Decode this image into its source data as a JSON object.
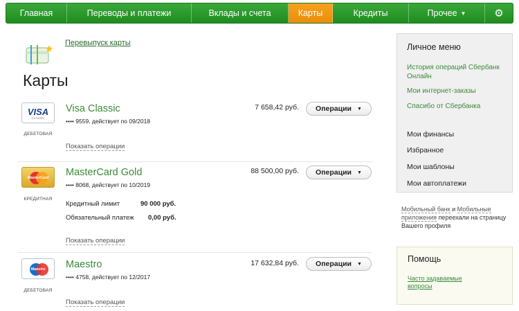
{
  "nav": {
    "items": [
      {
        "label": "Главная"
      },
      {
        "label": "Переводы и платежи"
      },
      {
        "label": "Вклады и счета"
      },
      {
        "label": "Карты"
      },
      {
        "label": "Кредиты"
      },
      {
        "label": "Прочее"
      }
    ],
    "active": "Карты",
    "settings_icon": "gear-icon"
  },
  "reissue_link": "Перевыпуск карты",
  "page_title": "Карты",
  "cards": [
    {
      "name": "Visa Classic",
      "type_label": "ДЕБЕТОВАЯ",
      "logo_text": "VISA",
      "logo_sub": "CLASSIC",
      "meta": "•••• 9559, действует по 09/2018",
      "amount": "7 658,42 руб.",
      "ops_label": "Операции",
      "show_ops": "Показать операции"
    },
    {
      "name": "MasterCard Gold",
      "type_label": "КРЕДИТНАЯ",
      "logo_text": "MasterCard",
      "meta": "•••• 8068, действует по 10/2019",
      "amount": "88 500,00 руб.",
      "ops_label": "Операции",
      "credit_limit_label": "Кредитный лимит",
      "credit_limit_value": "90 000 руб.",
      "min_payment_label": "Обязательный платеж",
      "min_payment_value": "0,00 руб.",
      "show_ops": "Показать операции"
    },
    {
      "name": "Maestro",
      "type_label": "ДЕБЕТОВАЯ",
      "logo_text": "Maestro",
      "meta": "•••• 4758, действует по 12/2017",
      "amount": "17 632,84 руб.",
      "ops_label": "Операции",
      "show_ops": "Показать операции"
    }
  ],
  "sidebar": {
    "title": "Личное меню",
    "links": [
      "История операций Сбербанк Онлайн",
      "Мои интернет-заказы",
      "Спасибо от Сбербанка"
    ],
    "items": [
      "Мои финансы",
      "Избранное",
      "Мои шаблоны",
      "Мои автоплатежи"
    ]
  },
  "mobile_note": {
    "link1": "Мобильный банк",
    "and": " и ",
    "link2": "Мобильные приложения",
    "rest": " переехали на страницу Вашего профиля"
  },
  "help": {
    "title": "Помощь",
    "faq_link": "Часто задаваемые вопросы"
  },
  "colors": {
    "nav_green": "#2a9a2a",
    "nav_active_orange": "#f39a15",
    "link_green": "#3a8a3a"
  }
}
